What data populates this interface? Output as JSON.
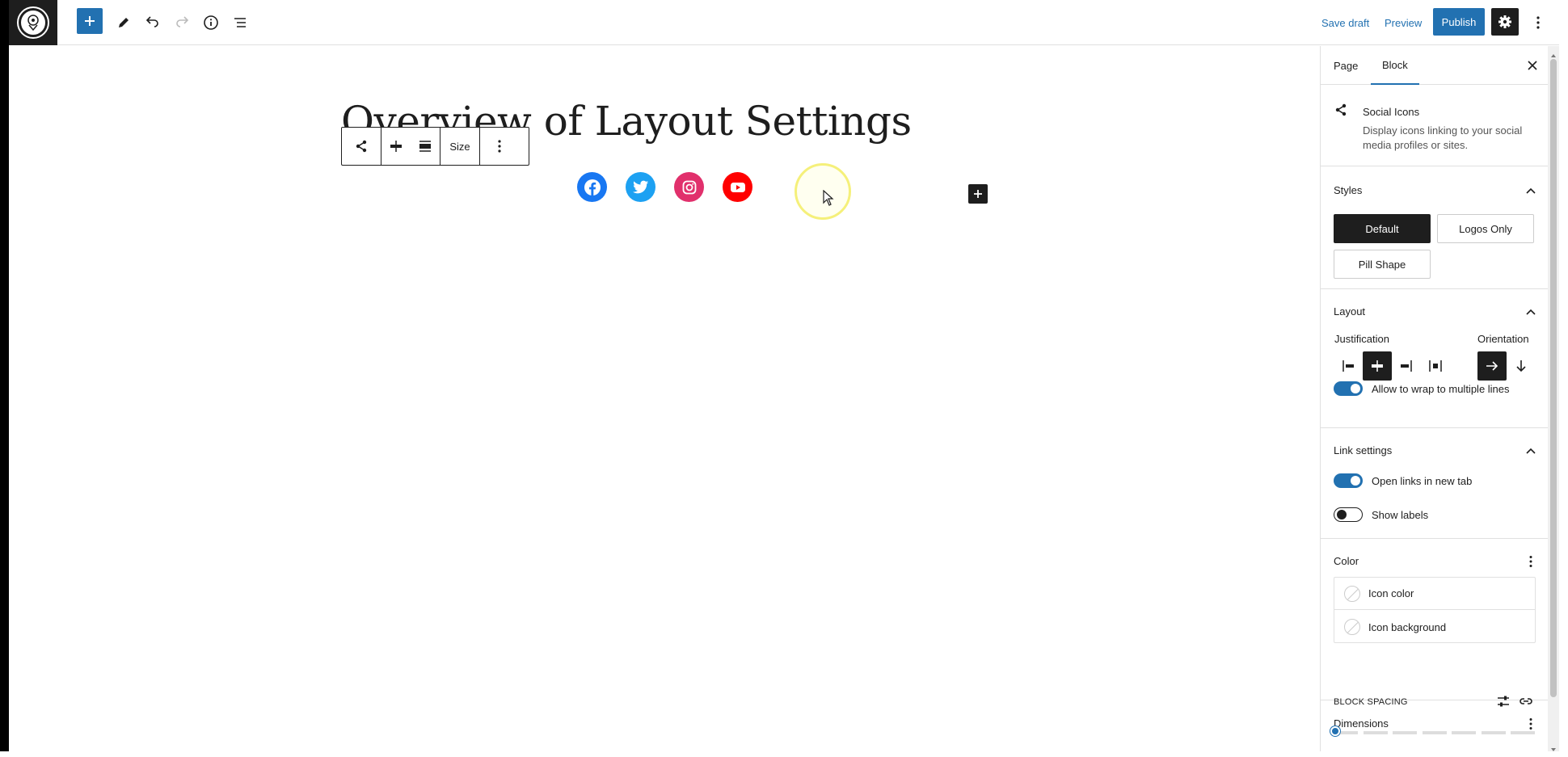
{
  "topbar": {
    "save_draft": "Save draft",
    "preview": "Preview",
    "publish": "Publish"
  },
  "canvas": {
    "title": "Overview of Layout Settings",
    "toolbar": {
      "size_label": "Size"
    },
    "social_links": [
      {
        "name": "facebook-icon",
        "color": "#1877f2"
      },
      {
        "name": "twitter-icon",
        "color": "#1da1f2"
      },
      {
        "name": "instagram-icon",
        "color": "#e1306c"
      },
      {
        "name": "youtube-icon",
        "color": "#ff0000"
      }
    ]
  },
  "sidebar": {
    "tabs": {
      "page": "Page",
      "block": "Block"
    },
    "block_card": {
      "title": "Social Icons",
      "description": "Display icons linking to your social media profiles or sites."
    },
    "styles": {
      "heading": "Styles",
      "default": "Default",
      "logos_only": "Logos Only",
      "pill_shape": "Pill Shape"
    },
    "layout": {
      "heading": "Layout",
      "justification": "Justification",
      "orientation": "Orientation",
      "wrap_label": "Allow to wrap to multiple lines",
      "wrap_on": true
    },
    "link_settings": {
      "heading": "Link settings",
      "open_new_tab": "Open links in new tab",
      "open_new_tab_on": true,
      "show_labels": "Show labels",
      "show_labels_on": false
    },
    "color": {
      "heading": "Color",
      "icon_color": "Icon color",
      "icon_background": "Icon background"
    },
    "dimensions": {
      "heading": "Dimensions",
      "block_spacing": "BLOCK SPACING"
    }
  },
  "colors": {
    "accent": "#2271b1",
    "dark": "#1e1e1e"
  }
}
